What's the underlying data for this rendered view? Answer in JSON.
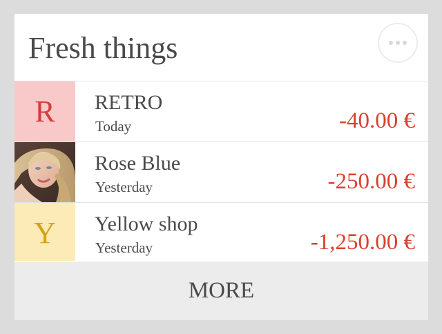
{
  "widget": {
    "title": "Fresh things",
    "menu_icon": "more-horizontal-icon"
  },
  "transactions": [
    {
      "name": "RETRO",
      "date": "Today",
      "amount": "-40.00 €",
      "avatar_type": "letter",
      "avatar_letter": "R",
      "avatar_bg": "#f9c9c9",
      "avatar_fg": "#d0413b"
    },
    {
      "name": "Rose Blue",
      "date": "Yesterday",
      "amount": "-250.00 €",
      "avatar_type": "photo",
      "avatar_letter": "",
      "avatar_bg": "#6b5247",
      "avatar_fg": ""
    },
    {
      "name": "Yellow shop",
      "date": "Yesterday",
      "amount": "-1,250.00 €",
      "avatar_type": "letter",
      "avatar_letter": "Y",
      "avatar_bg": "#fcebb6",
      "avatar_fg": "#d4a21b"
    }
  ],
  "more_label": "MORE",
  "colors": {
    "page_bg": "#dcdcdc",
    "card_bg": "#ffffff",
    "text": "#4a4a4a",
    "amount": "#d8412f",
    "divider": "#e2e2e2",
    "more_bg": "#ececec"
  }
}
